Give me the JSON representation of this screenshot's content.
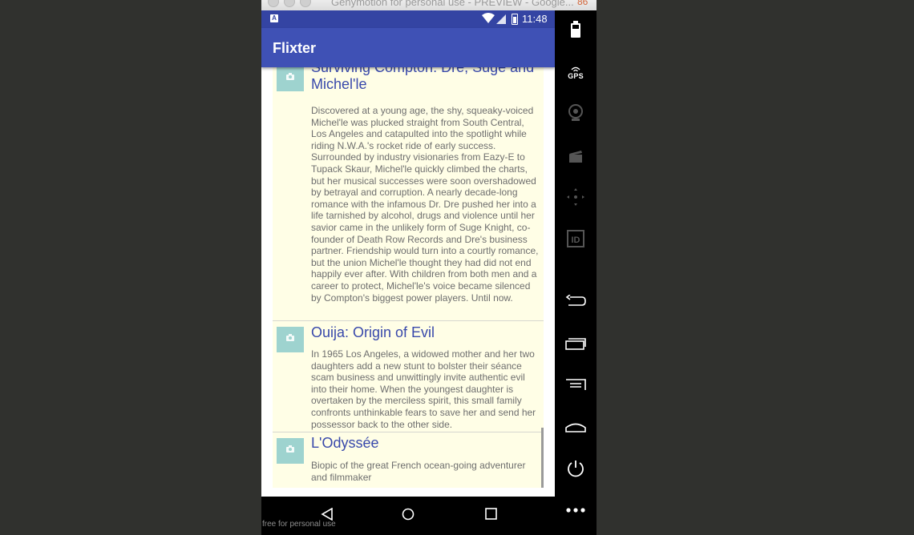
{
  "window": {
    "title": "Genymotion for personal use - PREVIEW - Google...",
    "badge": "86",
    "watermark": "free for personal use"
  },
  "status_bar": {
    "notification_icon": "A",
    "time": "11:48",
    "icons": [
      "wifi-icon",
      "signal-icon",
      "battery-icon"
    ]
  },
  "app_bar": {
    "title": "Flixter"
  },
  "movies": [
    {
      "title": "Surviving Compton: Dre, Suge and Michel'le",
      "overview": "Discovered at a young age, the shy, squeaky-voiced Michel'le was plucked straight from South Central, Los Angeles and catapulted into the spotlight while riding N.W.A.'s rocket ride of early success. Surrounded by industry visionaries from Eazy-E to Tupack Skaur, Michel'le quickly climbed the charts, but her musical successes were soon overshadowed by betrayal and corruption. A nearly decade-long romance with the infamous Dr. Dre pushed her into a life tarnished by alcohol, drugs and violence until her savior came in the unlikely form of Suge Knight, co-founder of Death Row Records and Dre's business partner. Friendship would turn into a courtly romance, but the union Michel'le thought they had did not end happily ever after. With children from both men and a career to protect, Michel'le's voice became silenced by Compton's biggest power players. Until now."
    },
    {
      "title": "Ouija: Origin of Evil",
      "overview": "In 1965 Los Angeles, a widowed mother and her two daughters add a new stunt to bolster their séance scam business and unwittingly invite authentic evil into their home. When the youngest daughter is overtaken by the merciless spirit, this small family confronts unthinkable fears to save her and send her possessor back to the other side."
    },
    {
      "title": "L'Odyssée",
      "overview": "Biopic of the great French ocean-going adventurer and filmmaker"
    }
  ],
  "nav_bar": {
    "buttons": [
      "back-icon",
      "home-icon",
      "recents-icon"
    ]
  },
  "side_toolbar": {
    "tools": [
      "battery-tool-icon",
      "gps-tool-icon",
      "webcam-tool-icon",
      "capture-tool-icon",
      "dpad-tool-icon",
      "identifier-tool-icon",
      "back-tool-icon",
      "recent-apps-tool-icon",
      "menu-tool-icon",
      "home-tool-icon",
      "power-tool-icon",
      "more-tool-icon"
    ],
    "gps_label": "GPS",
    "id_label": "ID"
  },
  "colors": {
    "primary": "#3f51b5",
    "primary_dark": "#3444a3",
    "list_background": "#fffee6",
    "title_text": "#3949ab",
    "thumbnail": "#9ed3cf"
  }
}
